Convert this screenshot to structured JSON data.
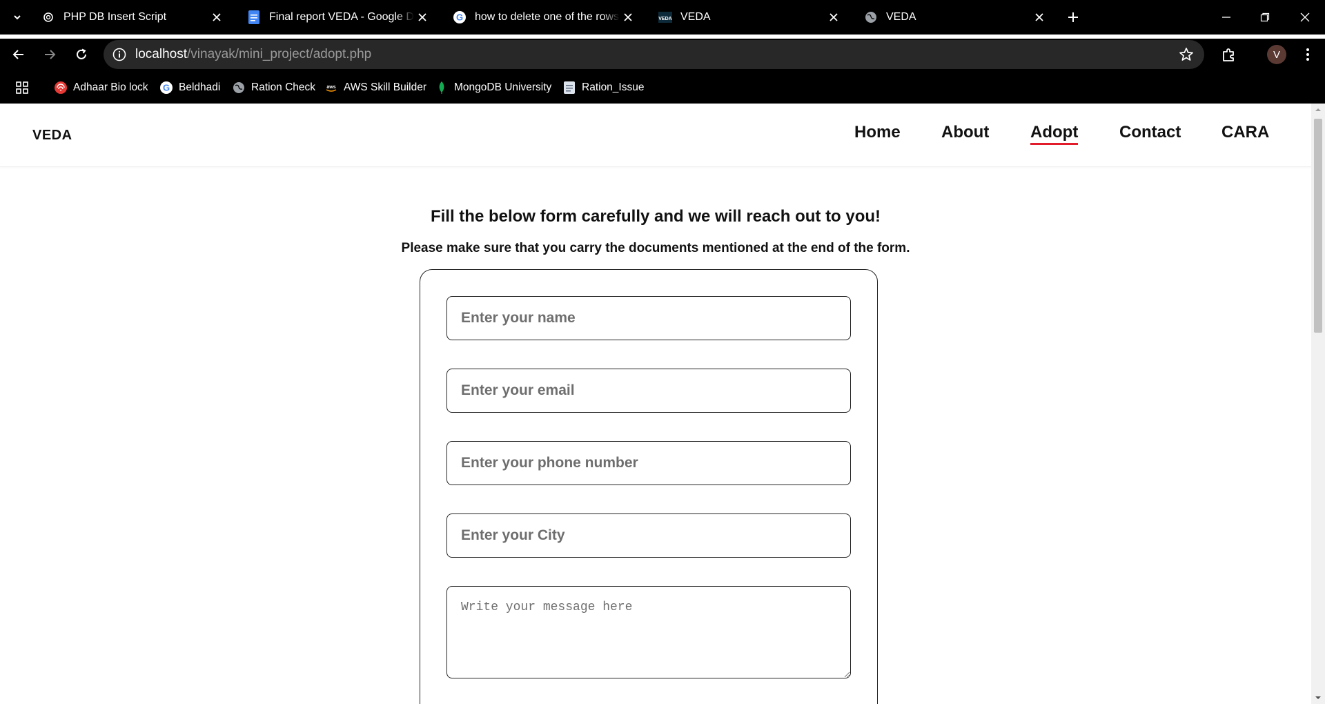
{
  "browser": {
    "tabs": [
      {
        "title": "PHP DB Insert Script",
        "favicon": "openai-icon"
      },
      {
        "title": "Final report VEDA - Google Docs",
        "favicon": "google-docs-icon"
      },
      {
        "title": "how to delete one of the rows in",
        "favicon": "google-icon"
      },
      {
        "title": "VEDA",
        "favicon": "veda-icon"
      },
      {
        "title": "VEDA",
        "favicon": "globe-icon"
      }
    ],
    "url_host": "localhost",
    "url_path": "/vinayak/mini_project/adopt.php",
    "profile_initial": "V",
    "bookmarks": [
      {
        "label": "Adhaar Bio lock",
        "icon": "fingerprint-icon"
      },
      {
        "label": "Beldhadi",
        "icon": "google-icon"
      },
      {
        "label": "Ration Check",
        "icon": "globe-icon"
      },
      {
        "label": "AWS Skill Builder",
        "icon": "aws-icon"
      },
      {
        "label": "MongoDB University",
        "icon": "mongodb-leaf-icon"
      },
      {
        "label": "Ration_Issue",
        "icon": "document-icon"
      }
    ]
  },
  "site": {
    "logo": "VEDA",
    "nav": {
      "home": "Home",
      "about": "About",
      "adopt": "Adopt",
      "contact": "Contact",
      "cara": "CARA"
    },
    "active_nav": "Adopt",
    "accent_color": "#e21c2a"
  },
  "form": {
    "heading": "Fill the below form carefully and we will reach out to you!",
    "subheading": "Please make sure that you carry the documents mentioned at the end of the form.",
    "name_placeholder": "Enter your name",
    "email_placeholder": "Enter your email",
    "phone_placeholder": "Enter your phone number",
    "city_placeholder": "Enter your City",
    "message_placeholder": "Write your message here"
  }
}
